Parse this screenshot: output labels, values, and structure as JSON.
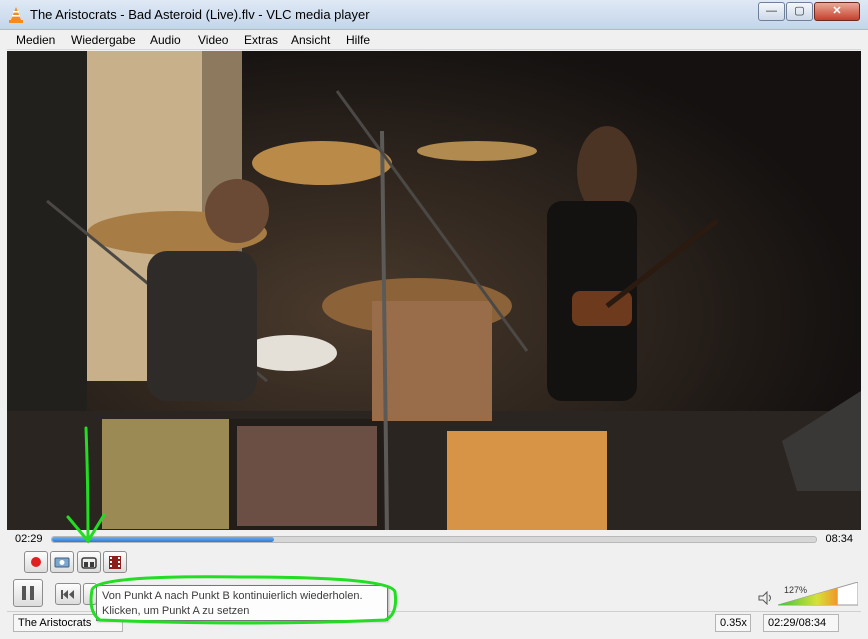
{
  "window": {
    "title": "The Aristocrats - Bad Asteroid (Live).flv - VLC media player",
    "minimize_glyph": "—",
    "maximize_glyph": "▢",
    "close_glyph": "✕"
  },
  "menu": {
    "items": [
      "Medien",
      "Wiedergabe",
      "Audio",
      "Video",
      "Extras",
      "Ansicht",
      "Hilfe"
    ]
  },
  "seek": {
    "elapsed": "02:29",
    "total": "08:34",
    "progress": 0.29
  },
  "controls": {
    "record_icon": "record-icon",
    "snapshot_icon": "camera-icon",
    "ab_loop_icon": "ab-loop-icon",
    "frame_step_icon": "film-frame-icon",
    "play_pause_icon": "pause-icon",
    "prev_icon": "previous-icon"
  },
  "tooltip": {
    "line1": "Von Punkt A nach Punkt B kontinuierlich wiederholen.",
    "line2": "Klicken, um Punkt A zu setzen"
  },
  "volume": {
    "percent_label": "127%",
    "level": 1.27
  },
  "status": {
    "playlist_title": "The Aristocrats",
    "speed": "0.35x",
    "time": "02:29/08:34"
  },
  "colors": {
    "seek_fill": "#2d7bd4",
    "annotation": "#22dd22",
    "record_red": "#e02020"
  }
}
